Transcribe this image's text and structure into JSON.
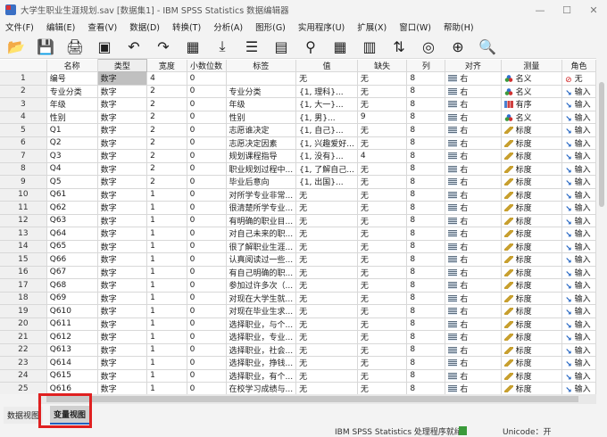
{
  "window": {
    "title": "大学生职业生涯规划.sav [数据集1] - IBM SPSS Statistics 数据编辑器",
    "minimize": "—",
    "maximize": "☐",
    "close": "✕"
  },
  "menu": [
    "文件(F)",
    "编辑(E)",
    "查看(V)",
    "数据(D)",
    "转换(T)",
    "分析(A)",
    "图形(G)",
    "实用程序(U)",
    "扩展(X)",
    "窗口(W)",
    "帮助(H)"
  ],
  "toolbar": [
    {
      "name": "open-icon",
      "glyph": "📂"
    },
    {
      "name": "save-icon",
      "glyph": "💾"
    },
    {
      "name": "print-icon",
      "glyph": "🖨"
    },
    {
      "name": "dialog-recall-icon",
      "glyph": "▣"
    },
    {
      "name": "undo-icon",
      "glyph": "↶"
    },
    {
      "name": "redo-icon",
      "glyph": "↷"
    },
    {
      "name": "goto-case-icon",
      "glyph": "▦"
    },
    {
      "name": "goto-variable-icon",
      "glyph": "⤓"
    },
    {
      "name": "variables-icon",
      "glyph": "☰"
    },
    {
      "name": "run-descriptives-icon",
      "glyph": "▤"
    },
    {
      "name": "find-icon",
      "glyph": "⚲"
    },
    {
      "name": "insert-cases-icon",
      "glyph": "▦"
    },
    {
      "name": "insert-variable-icon",
      "glyph": "▥"
    },
    {
      "name": "split-file-icon",
      "glyph": "⇅"
    },
    {
      "name": "weight-cases-icon",
      "glyph": "◎"
    },
    {
      "name": "select-cases-icon",
      "glyph": "⊕"
    },
    {
      "name": "search-icon",
      "glyph": "🔍"
    }
  ],
  "columns": [
    "名称",
    "类型",
    "宽度",
    "小数位数",
    "标签",
    "值",
    "缺失",
    "列",
    "对齐",
    "测量",
    "角色"
  ],
  "rows": [
    [
      "1",
      "编号",
      "数字",
      "4",
      "0",
      "",
      "无",
      "无",
      "8",
      "右",
      "名义",
      "无"
    ],
    [
      "2",
      "专业分类",
      "数字",
      "2",
      "0",
      "专业分类",
      "{1, 理科}...",
      "无",
      "8",
      "右",
      "名义",
      "输入"
    ],
    [
      "3",
      "年级",
      "数字",
      "2",
      "0",
      "年级",
      "{1, 大一}...",
      "无",
      "8",
      "右",
      "有序",
      "输入"
    ],
    [
      "4",
      "性别",
      "数字",
      "2",
      "0",
      "性别",
      "{1, 男}...",
      "9",
      "8",
      "右",
      "名义",
      "输入"
    ],
    [
      "5",
      "Q1",
      "数字",
      "2",
      "0",
      "志愿谁决定",
      "{1, 自己}...",
      "无",
      "8",
      "右",
      "标度",
      "输入"
    ],
    [
      "6",
      "Q2",
      "数字",
      "2",
      "0",
      "志愿决定因素",
      "{1, 兴趣爱好...",
      "无",
      "8",
      "右",
      "标度",
      "输入"
    ],
    [
      "7",
      "Q3",
      "数字",
      "2",
      "0",
      "规划课程指导",
      "{1, 没有}...",
      "4",
      "8",
      "右",
      "标度",
      "输入"
    ],
    [
      "8",
      "Q4",
      "数字",
      "2",
      "0",
      "职业规划过程中...",
      "{1, 了解自己...",
      "无",
      "8",
      "右",
      "标度",
      "输入"
    ],
    [
      "9",
      "Q5",
      "数字",
      "2",
      "0",
      "毕业后意向",
      "{1, 出国}...",
      "无",
      "8",
      "右",
      "标度",
      "输入"
    ],
    [
      "10",
      "Q61",
      "数字",
      "1",
      "0",
      "对所学专业非常...",
      "无",
      "无",
      "8",
      "右",
      "标度",
      "输入"
    ],
    [
      "11",
      "Q62",
      "数字",
      "1",
      "0",
      "很清楚所学专业...",
      "无",
      "无",
      "8",
      "右",
      "标度",
      "输入"
    ],
    [
      "12",
      "Q63",
      "数字",
      "1",
      "0",
      "有明确的职业目...",
      "无",
      "无",
      "8",
      "右",
      "标度",
      "输入"
    ],
    [
      "13",
      "Q64",
      "数字",
      "1",
      "0",
      "对自己未来的职...",
      "无",
      "无",
      "8",
      "右",
      "标度",
      "输入"
    ],
    [
      "14",
      "Q65",
      "数字",
      "1",
      "0",
      "很了解职业生涯...",
      "无",
      "无",
      "8",
      "右",
      "标度",
      "输入"
    ],
    [
      "15",
      "Q66",
      "数字",
      "1",
      "0",
      "认真阅读过一些...",
      "无",
      "无",
      "8",
      "右",
      "标度",
      "输入"
    ],
    [
      "16",
      "Q67",
      "数字",
      "1",
      "0",
      "有自己明确的职...",
      "无",
      "无",
      "8",
      "右",
      "标度",
      "输入"
    ],
    [
      "17",
      "Q68",
      "数字",
      "1",
      "0",
      "参加过许多次（...",
      "无",
      "无",
      "8",
      "右",
      "标度",
      "输入"
    ],
    [
      "18",
      "Q69",
      "数字",
      "1",
      "0",
      "对现在大学生就...",
      "无",
      "无",
      "8",
      "右",
      "标度",
      "输入"
    ],
    [
      "19",
      "Q610",
      "数字",
      "1",
      "0",
      "对现在毕业生求...",
      "无",
      "无",
      "8",
      "右",
      "标度",
      "输入"
    ],
    [
      "20",
      "Q611",
      "数字",
      "1",
      "0",
      "选择职业，与个...",
      "无",
      "无",
      "8",
      "右",
      "标度",
      "输入"
    ],
    [
      "21",
      "Q612",
      "数字",
      "1",
      "0",
      "选择职业，专业...",
      "无",
      "无",
      "8",
      "右",
      "标度",
      "输入"
    ],
    [
      "22",
      "Q613",
      "数字",
      "1",
      "0",
      "选择职业，社会...",
      "无",
      "无",
      "8",
      "右",
      "标度",
      "输入"
    ],
    [
      "23",
      "Q614",
      "数字",
      "1",
      "0",
      "选择职业，挣钱...",
      "无",
      "无",
      "8",
      "右",
      "标度",
      "输入"
    ],
    [
      "24",
      "Q615",
      "数字",
      "1",
      "0",
      "选择职业，有个...",
      "无",
      "无",
      "8",
      "右",
      "标度",
      "输入"
    ],
    [
      "25",
      "Q616",
      "数字",
      "1",
      "0",
      "在校学习成绩与...",
      "无",
      "无",
      "8",
      "右",
      "标度",
      "输入"
    ]
  ],
  "tabs": {
    "data_view": "数据视图",
    "variable_view": "变量视图"
  },
  "status": {
    "processor": "IBM SPSS Statistics 处理程序就绪",
    "unicode": "Unicode：开"
  }
}
